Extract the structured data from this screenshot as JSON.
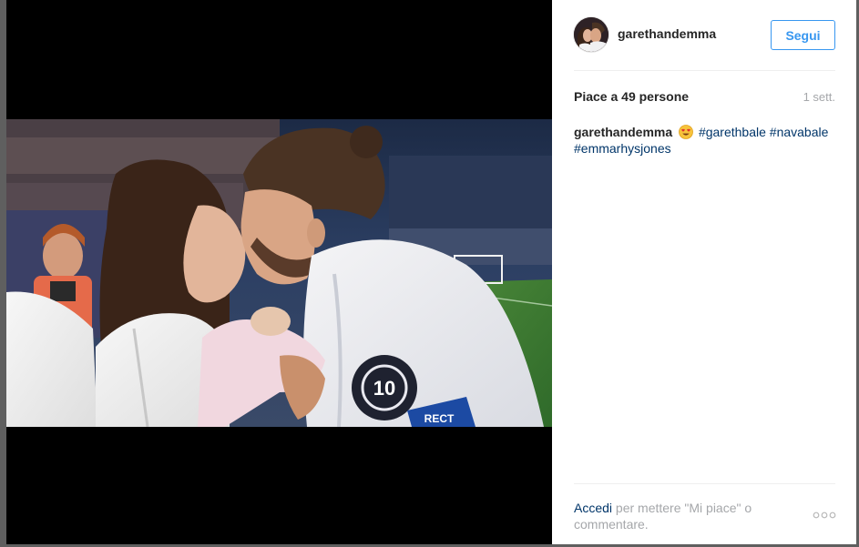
{
  "post": {
    "username": "garethandemma",
    "follow_label": "Segui",
    "likes_text": "Piace a 49 persone",
    "time_text": "1 sett.",
    "caption": {
      "username": "garethandemma",
      "emoji": "smiling-face-with-heart-eyes-emoji",
      "hashtags": [
        "#garethbale",
        "#navabale",
        "#emmarhysjones"
      ]
    },
    "photo_text": {
      "badge_letters": "10",
      "band_text": "RECT"
    },
    "login_prompt": {
      "link": "Accedi",
      "text": "per mettere \"Mi piace\" o commentare."
    },
    "more_icon": "ellipsis-icon"
  },
  "colors": {
    "link": "#3897f0",
    "hashtag": "#003569",
    "muted": "#a5a7aa",
    "text": "#262626",
    "media_bg": "#000000"
  }
}
